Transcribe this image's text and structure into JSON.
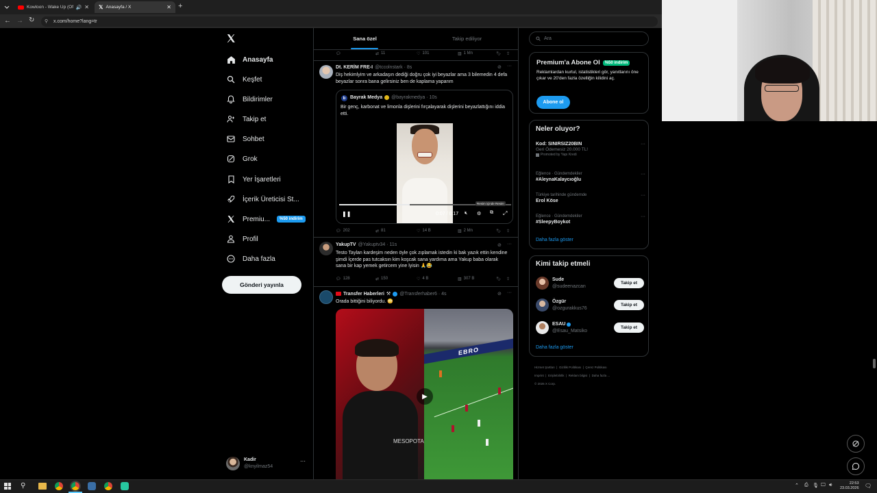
{
  "browser": {
    "tabs": [
      {
        "label": "Kowloon - Wake Up (Offici"
      },
      {
        "label": "Anasayfa / X"
      }
    ],
    "url": "x.com/home?lang=tr"
  },
  "nav": {
    "items": [
      {
        "label": "Anasayfa",
        "icon": "home-icon"
      },
      {
        "label": "Keşfet",
        "icon": "search-icon"
      },
      {
        "label": "Bildirimler",
        "icon": "bell-icon"
      },
      {
        "label": "Takip et",
        "icon": "add-person-icon"
      },
      {
        "label": "Sohbet",
        "icon": "mail-icon"
      },
      {
        "label": "Grok",
        "icon": "grok-icon"
      },
      {
        "label": "Yer İşaretleri",
        "icon": "bookmark-icon"
      },
      {
        "label": "İçerik Üreticisi St...",
        "icon": "rocket-icon"
      },
      {
        "label": "Premiu...",
        "icon": "x-logo-icon",
        "badge": "%50 indirim"
      },
      {
        "label": "Profil",
        "icon": "person-icon"
      },
      {
        "label": "Daha fazla",
        "icon": "more-circle-icon"
      }
    ],
    "post_button": "Gönderi yayınla",
    "account": {
      "name": "Kadir",
      "handle": "@knyilmaz54"
    }
  },
  "feed": {
    "tabs": [
      {
        "label": "Sana özel"
      },
      {
        "label": "Takip ediliyor"
      }
    ],
    "top_stats": {
      "retweets": "11",
      "likes": "101",
      "views": "1 Mn"
    },
    "tweets": [
      {
        "name": "Dt. KERİM FRE-I",
        "handle": "@tccolnstark · 8s",
        "text": "Diş hekimlyim ve arkadaşın dediği doğru çok iyi beyazlar ama 3 bilemedin 4 defa beyazlar sonra bana gelirsiniz ben de kaplama yaparım",
        "quote": {
          "name": "Bayrak Medya",
          "handle": "@bayrakmedya · 10s",
          "text": "Bir genç, karbonat ve limonla dişlerini fırçalayarak dişlerini beyazlattığını iddia etti.",
          "video_time": "0:07 / 0:17",
          "video_progress": 0.41,
          "tooltip": "Resim içinde Resim"
        },
        "replies": "202",
        "retweets": "81",
        "likes": "14 B",
        "views": "2 Mn"
      },
      {
        "name": "YakupTV",
        "handle": "@Yakuptv34 · 11s",
        "text": "Testo Taylan kardeşim neden öyle çok zıplamak istedin ki bak yazık ettin kendine şimdi İçerde pas tutcaksın kim koşcak sana yardıma ama Yakup baba olarak sana bir kap yemek getircem yine lyisin 🙏😂",
        "replies": "128",
        "retweets": "150",
        "likes": "4 B",
        "views": "307 B"
      },
      {
        "name": "Transfer Haberleri",
        "handle": "@Transferhaber6 · 4s",
        "text": "Orada bittiğini biliyordu. 😳",
        "media_overlay_text": "MESOPOTA",
        "ad_board": "EBRO"
      }
    ]
  },
  "right": {
    "search_placeholder": "Ara",
    "premium": {
      "title": "Premium'a Abone Ol",
      "badge": "%50 indirim",
      "text": "Reklamlardan kurtul, istatistikleri gör, yanıtlarını öne çıkar ve 20'den fazla özelliğin kilidini aç.",
      "button": "Abone ol"
    },
    "trends": {
      "title": "Neler oluyor?",
      "items": [
        {
          "meta": "",
          "name": "Kod: SINIRSIZ20BIN",
          "sub": "Geri Ödemesiz 20.000 TL!",
          "promoted": "Promoted by Yapı Kredi"
        },
        {
          "meta": "Eğlence · Gündemdekiler",
          "name": "#AleynaKalaycıoğlu",
          "sub": "",
          "promoted": ""
        },
        {
          "meta": "Türkiye tarihinde gündemde",
          "name": "Erol Köse",
          "sub": "",
          "promoted": ""
        },
        {
          "meta": "Eğlence · Gündemdekiler",
          "name": "#SleepyBoykot",
          "sub": "",
          "promoted": ""
        }
      ],
      "more": "Daha fazla göster"
    },
    "follow": {
      "title": "Kimi takip etmeli",
      "items": [
        {
          "name": "Sude",
          "handle": "@sudeenazcan",
          "button": "Takip et"
        },
        {
          "name": "Özgür",
          "handle": "@ozgurakkus76",
          "button": "Takip et"
        },
        {
          "name": "ESAU",
          "handle": "@Esau_Matsiko",
          "button": "Takip et"
        }
      ],
      "more": "Daha fazla göster"
    },
    "footer": {
      "links": [
        "Hizmet Şartları",
        "Gizlilik Politikası",
        "Çerez Politikası",
        "Imprint",
        "Erişilebilirlik",
        "Reklam bilgisi",
        "Daha fazla ..."
      ],
      "copyright": "© 2026 X Corp."
    }
  },
  "taskbar": {
    "time": "22:53",
    "date": "23.03.2026"
  },
  "colors": {
    "accent": "#1d9bf0",
    "background": "#000000",
    "premium_green": "#00ba7c",
    "text_muted": "#71767b"
  }
}
